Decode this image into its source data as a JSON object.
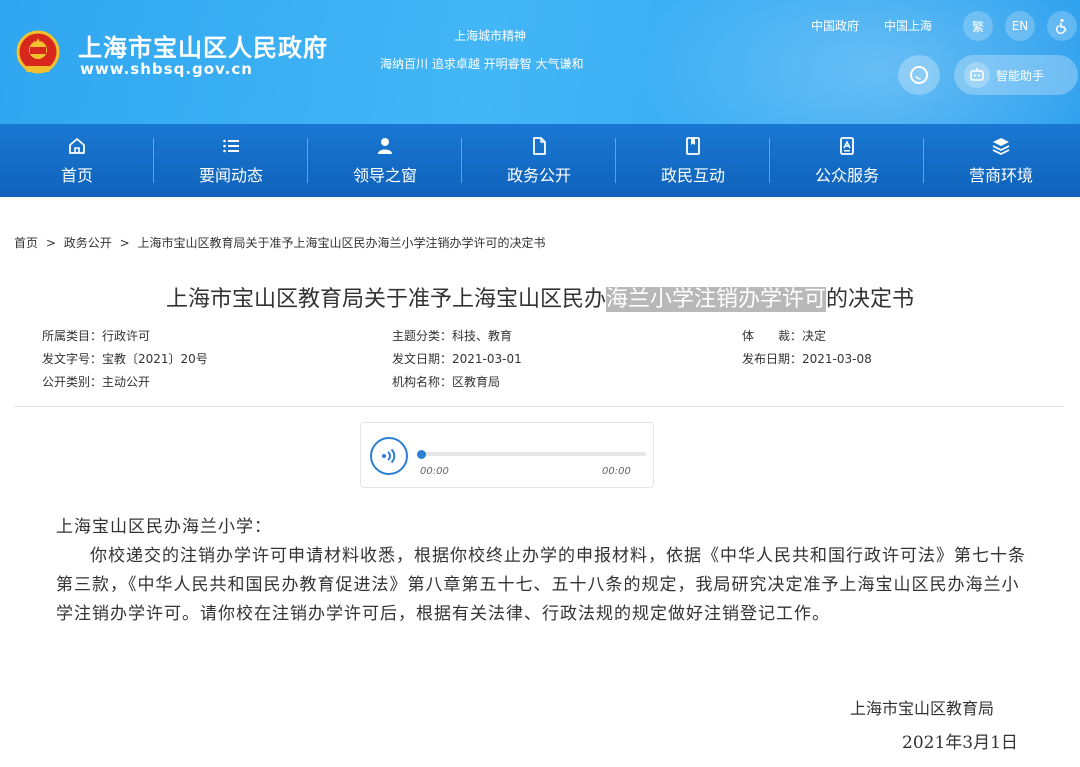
{
  "header": {
    "site_name": "上海市宝山区人民政府",
    "site_url": "www.shbsq.gov.cn",
    "spirit_title": "上海城市精神",
    "spirit_text": "海纳百川 追求卓越 开明睿智 大气谦和",
    "links": [
      "中国政府",
      "中国上海"
    ],
    "lang_traditional": "繁",
    "lang_en": "EN",
    "assistant_label": "智能助手"
  },
  "nav": {
    "items": [
      {
        "label": "首页",
        "icon": "home-icon"
      },
      {
        "label": "要闻动态",
        "icon": "list-icon"
      },
      {
        "label": "领导之窗",
        "icon": "person-icon"
      },
      {
        "label": "政务公开",
        "icon": "document-icon"
      },
      {
        "label": "政民互动",
        "icon": "bookmark-icon"
      },
      {
        "label": "公众服务",
        "icon": "service-icon"
      },
      {
        "label": "营商环境",
        "icon": "layers-icon"
      }
    ]
  },
  "breadcrumb": {
    "items": [
      "首页",
      "政务公开",
      "上海市宝山区教育局关于准予上海宝山区民办海兰小学注销办学许可的决定书"
    ],
    "sep": ">"
  },
  "doc": {
    "title_pre": "上海市宝山区教育局关于准予上海宝山区民办",
    "title_hl": "海兰小学注销办学许可",
    "title_post": "的决定书",
    "meta": {
      "category": "所属类目：行政许可",
      "topic": "主题分类：科技、教育",
      "genre": "体　　裁：决定",
      "doc_no": "发文字号：宝教〔2021〕20号",
      "issue_date": "发文日期：2021-03-01",
      "publish_date": "发布日期：2021-03-08",
      "open_type": "公开类别：主动公开",
      "agency": "机构名称：区教育局"
    }
  },
  "player": {
    "current": "00:00",
    "total": "00:00",
    "progress": 0
  },
  "body": {
    "salutation": "上海宝山区民办海兰小学：",
    "paragraph": "你校递交的注销办学许可申请材料收悉，根据你校终止办学的申报材料，依据《中华人民共和国行政许可法》第七十条第三款，《中华人民共和国民办教育促进法》第八章第五十七、五十八条的规定，我局研究决定准予上海宝山区民办海兰小学注销办学许可。请你校在注销办学许可后，根据有关法律、行政法规的规定做好注销登记工作。",
    "signature": "上海市宝山区教育局",
    "date": "2021年3月1日"
  },
  "colors": {
    "header_bg": "#3aaef3",
    "nav_bg": "#1368c3",
    "accent": "#2d7fd3"
  }
}
